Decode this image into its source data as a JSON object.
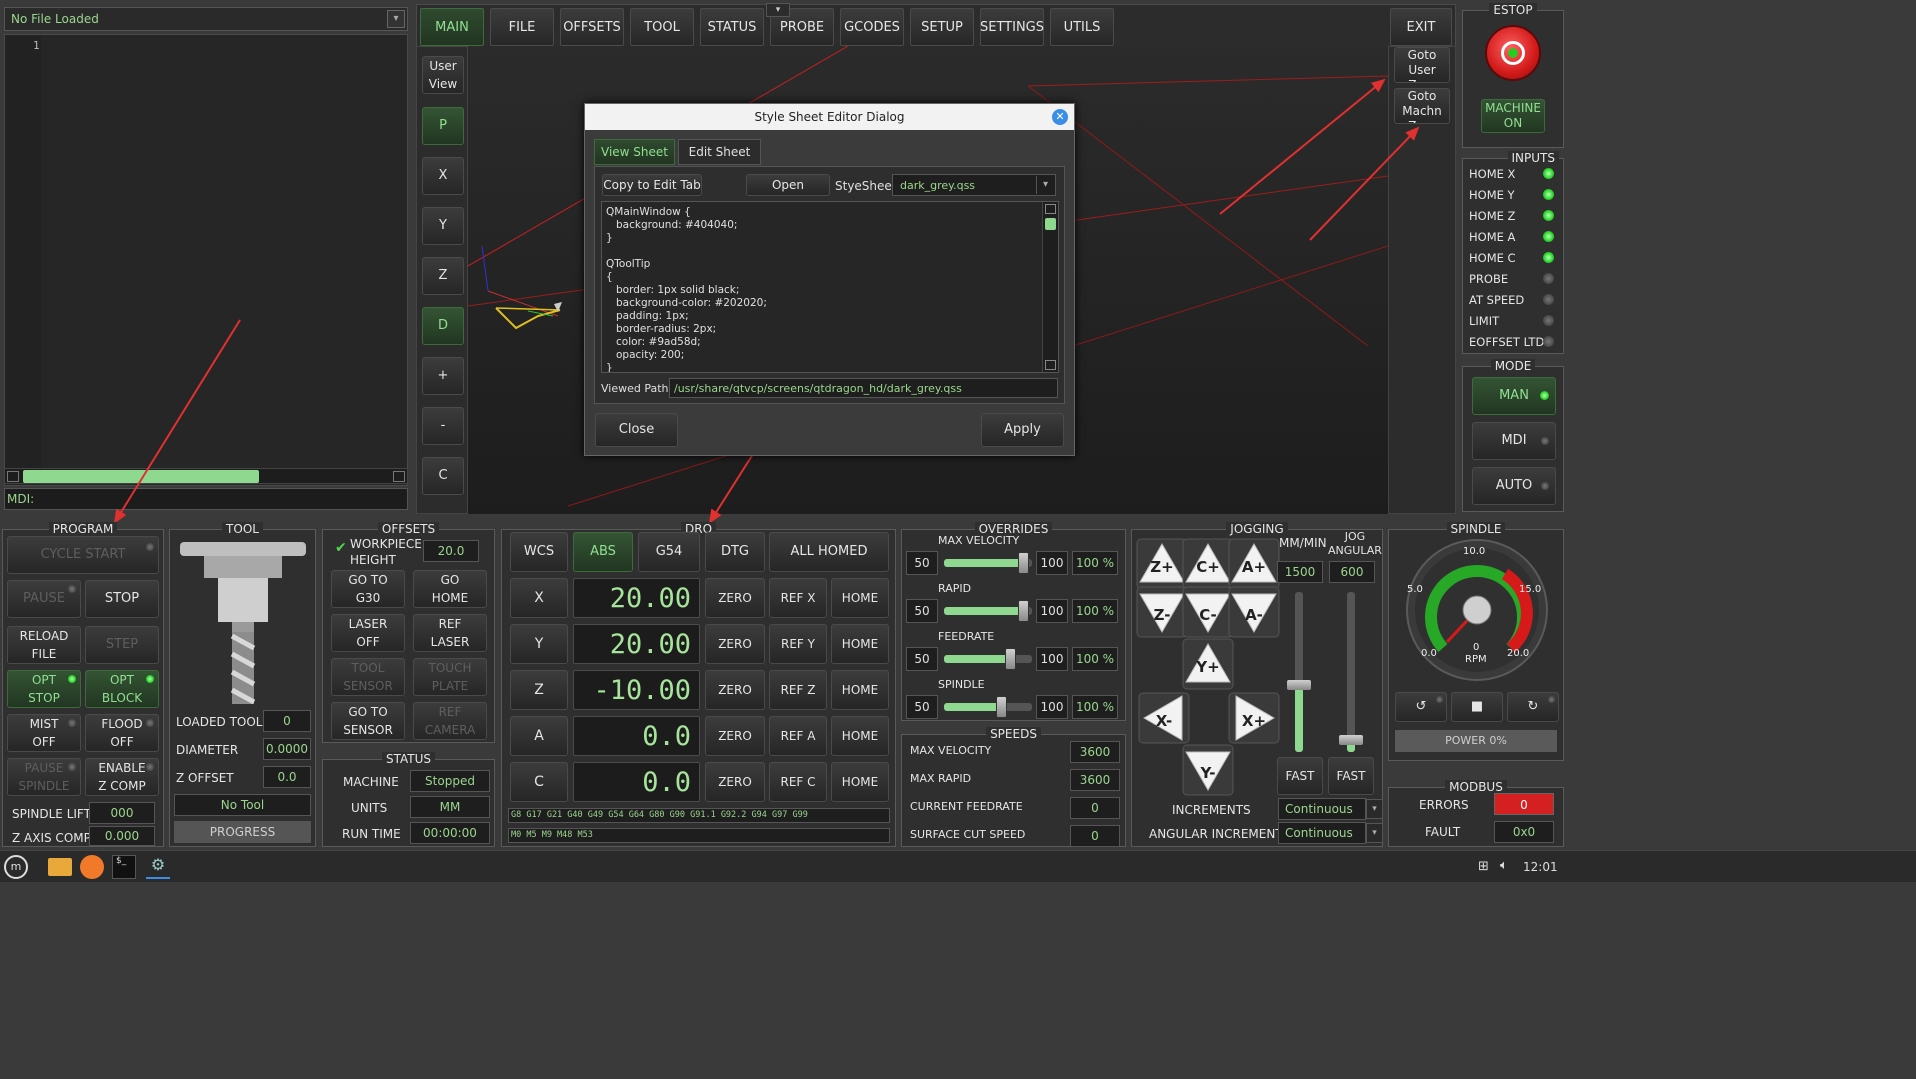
{
  "left": {
    "file_label": "No File Loaded",
    "line_number": "1",
    "mdi_label": "MDI:"
  },
  "tabs": [
    "MAIN",
    "FILE",
    "OFFSETS",
    "TOOL",
    "STATUS",
    "PROBE",
    "GCODES",
    "SETUP",
    "SETTINGS",
    "UTILS"
  ],
  "exit_label": "EXIT",
  "view_buttons": {
    "user_view": "User\nView",
    "p": "P",
    "x": "X",
    "y": "Y",
    "z": "Z",
    "d": "D",
    "plus": "+",
    "minus": "-",
    "c": "C"
  },
  "goto_buttons": {
    "user_zero": "Goto\nUser\nZero",
    "machine_zero": "Goto\nMachn\nZero"
  },
  "estop": {
    "title": "ESTOP",
    "machine_on": "MACHINE\nON"
  },
  "inputs": {
    "title": "INPUTS",
    "items": [
      {
        "label": "HOME X",
        "on": true
      },
      {
        "label": "HOME Y",
        "on": true
      },
      {
        "label": "HOME Z",
        "on": true
      },
      {
        "label": "HOME A",
        "on": true
      },
      {
        "label": "HOME C",
        "on": true
      },
      {
        "label": "PROBE",
        "on": false
      },
      {
        "label": "AT SPEED",
        "on": false
      },
      {
        "label": "LIMIT",
        "on": false
      },
      {
        "label": "EOFFSET LTD",
        "on": false
      }
    ]
  },
  "mode": {
    "title": "MODE",
    "man": "MAN",
    "mdi": "MDI",
    "auto": "AUTO"
  },
  "dialog": {
    "title": "Style Sheet Editor Dialog",
    "tab_view": "View Sheet",
    "tab_edit": "Edit Sheet",
    "copy_button": "Copy to Edit Tab",
    "open_button": "Open",
    "stylesheet_label": "StyeSheet:",
    "stylesheet_value": "dark_grey.qss",
    "code_lines": [
      "QMainWindow {",
      "   background: #404040;",
      "}",
      "",
      "QToolTip",
      "{",
      "   border: 1px solid black;",
      "   background-color: #202020;",
      "   padding: 1px;",
      "   border-radius: 2px;",
      "   color: #9ad58d;",
      "   opacity: 200;",
      "}"
    ],
    "viewed_path_label": "Viewed Path:",
    "viewed_path": "/usr/share/qtvcp/screens/qtdragon_hd/dark_grey.qss",
    "close_button": "Close",
    "apply_button": "Apply"
  },
  "program": {
    "title": "PROGRAM",
    "cycle_start": "CYCLE START",
    "pause": "PAUSE",
    "stop": "STOP",
    "reload": "RELOAD\nFILE",
    "step": "STEP",
    "opt_stop": "OPT\nSTOP",
    "opt_block": "OPT\nBLOCK",
    "mist": "MIST\nOFF",
    "flood": "FLOOD\nOFF",
    "pause_spindle": "PAUSE\nSPINDLE",
    "enable_zcomp": "ENABLE\nZ COMP",
    "spindle_lift_label": "SPINDLE LIFT",
    "spindle_lift_value": "000",
    "zaxis_comp_label": "Z AXIS COMP",
    "zaxis_comp_value": "0.000"
  },
  "tool": {
    "title": "TOOL",
    "loaded_label": "LOADED TOOL",
    "loaded_value": "0",
    "diameter_label": "DIAMETER",
    "diameter_value": "0.0000",
    "zoffset_label": "Z OFFSET",
    "zoffset_value": "0.0",
    "no_tool": "No Tool",
    "progress": "PROGRESS"
  },
  "offsets": {
    "title": "OFFSETS",
    "wp_label": "WORKPIECE\nHEIGHT",
    "wp_value": "20.0",
    "goto_g30": "GO TO\nG30",
    "go_home": "GO\nHOME",
    "laser_off": "LASER\nOFF",
    "ref_laser": "REF\nLASER",
    "tool_sensor": "TOOL\nSENSOR",
    "touch_plate": "TOUCH\nPLATE",
    "goto_sensor": "GO TO\nSENSOR",
    "ref_camera": "REF\nCAMERA"
  },
  "status": {
    "title": "STATUS",
    "machine_label": "MACHINE",
    "machine_value": "Stopped",
    "units_label": "UNITS",
    "units_value": "MM",
    "runtime_label": "RUN TIME",
    "runtime_value": "00:00:00"
  },
  "dro": {
    "title": "DRO",
    "wcs": "WCS",
    "abs": "ABS",
    "g54": "G54",
    "dtg": "DTG",
    "all_homed": "ALL HOMED",
    "axes": [
      {
        "axis": "X",
        "value": "20.00",
        "zero": "ZERO",
        "ref": "REF X",
        "home": "HOME"
      },
      {
        "axis": "Y",
        "value": "20.00",
        "zero": "ZERO",
        "ref": "REF Y",
        "home": "HOME"
      },
      {
        "axis": "Z",
        "value": "-10.00",
        "zero": "ZERO",
        "ref": "REF Z",
        "home": "HOME"
      },
      {
        "axis": "A",
        "value": "0.0",
        "zero": "ZERO",
        "ref": "REF A",
        "home": "HOME"
      },
      {
        "axis": "C",
        "value": "0.0",
        "zero": "ZERO",
        "ref": "REF C",
        "home": "HOME"
      }
    ],
    "gcodes": "G8 G17 G21 G40 G49 G54 G64 G80 G90 G91.1 G92.2 G94 G97 G99",
    "mcodes": "M0 M5 M9 M48 M53"
  },
  "overrides": {
    "title": "OVERRIDES",
    "rows": [
      {
        "label": "MAX VELOCITY",
        "min": "50",
        "max": "100",
        "pct": "100 %",
        "level": 0.9
      },
      {
        "label": "RAPID",
        "min": "50",
        "max": "100",
        "pct": "100 %",
        "level": 0.9
      },
      {
        "label": "FEEDRATE",
        "min": "50",
        "max": "100",
        "pct": "100 %",
        "level": 0.75
      },
      {
        "label": "SPINDLE",
        "min": "50",
        "max": "100",
        "pct": "100 %",
        "level": 0.65
      }
    ]
  },
  "speeds": {
    "title": "SPEEDS",
    "rows": [
      {
        "label": "MAX VELOCITY",
        "value": "3600"
      },
      {
        "label": "MAX RAPID",
        "value": "3600"
      },
      {
        "label": "CURRENT FEEDRATE",
        "value": "0"
      },
      {
        "label": "SURFACE CUT SPEED",
        "value": "0"
      }
    ]
  },
  "jogging": {
    "title": "JOGGING",
    "mm_min": "MM/MIN",
    "jog_angular": "JOG\nANGULAR",
    "lin_speed": "1500",
    "ang_speed": "600",
    "fast1": "FAST",
    "fast2": "FAST",
    "increments_label": "INCREMENTS",
    "increments_value": "Continuous",
    "ang_inc_label": "ANGULAR INCREMENT",
    "ang_inc_value": "Continuous",
    "keys": [
      "Z+",
      "C+",
      "A+",
      "Z-",
      "C-",
      "A-",
      "Y+",
      "X-",
      "X+",
      "Y-"
    ]
  },
  "spindle": {
    "title": "SPINDLE",
    "gauge_ticks": [
      "0.0",
      "5.0",
      "10.0",
      "15.0",
      "20.0"
    ],
    "rpm_value": "0",
    "rpm_label": "RPM",
    "power": "POWER 0%"
  },
  "modbus": {
    "title": "MODBUS",
    "errors_label": "ERRORS",
    "errors_value": "0",
    "fault_label": "FAULT",
    "fault_value": "0x0"
  },
  "taskbar": {
    "time": "12:01"
  },
  "colors": {
    "accent": "#9ad58d",
    "led_on": "#2fdc2f",
    "error": "#d42020"
  }
}
